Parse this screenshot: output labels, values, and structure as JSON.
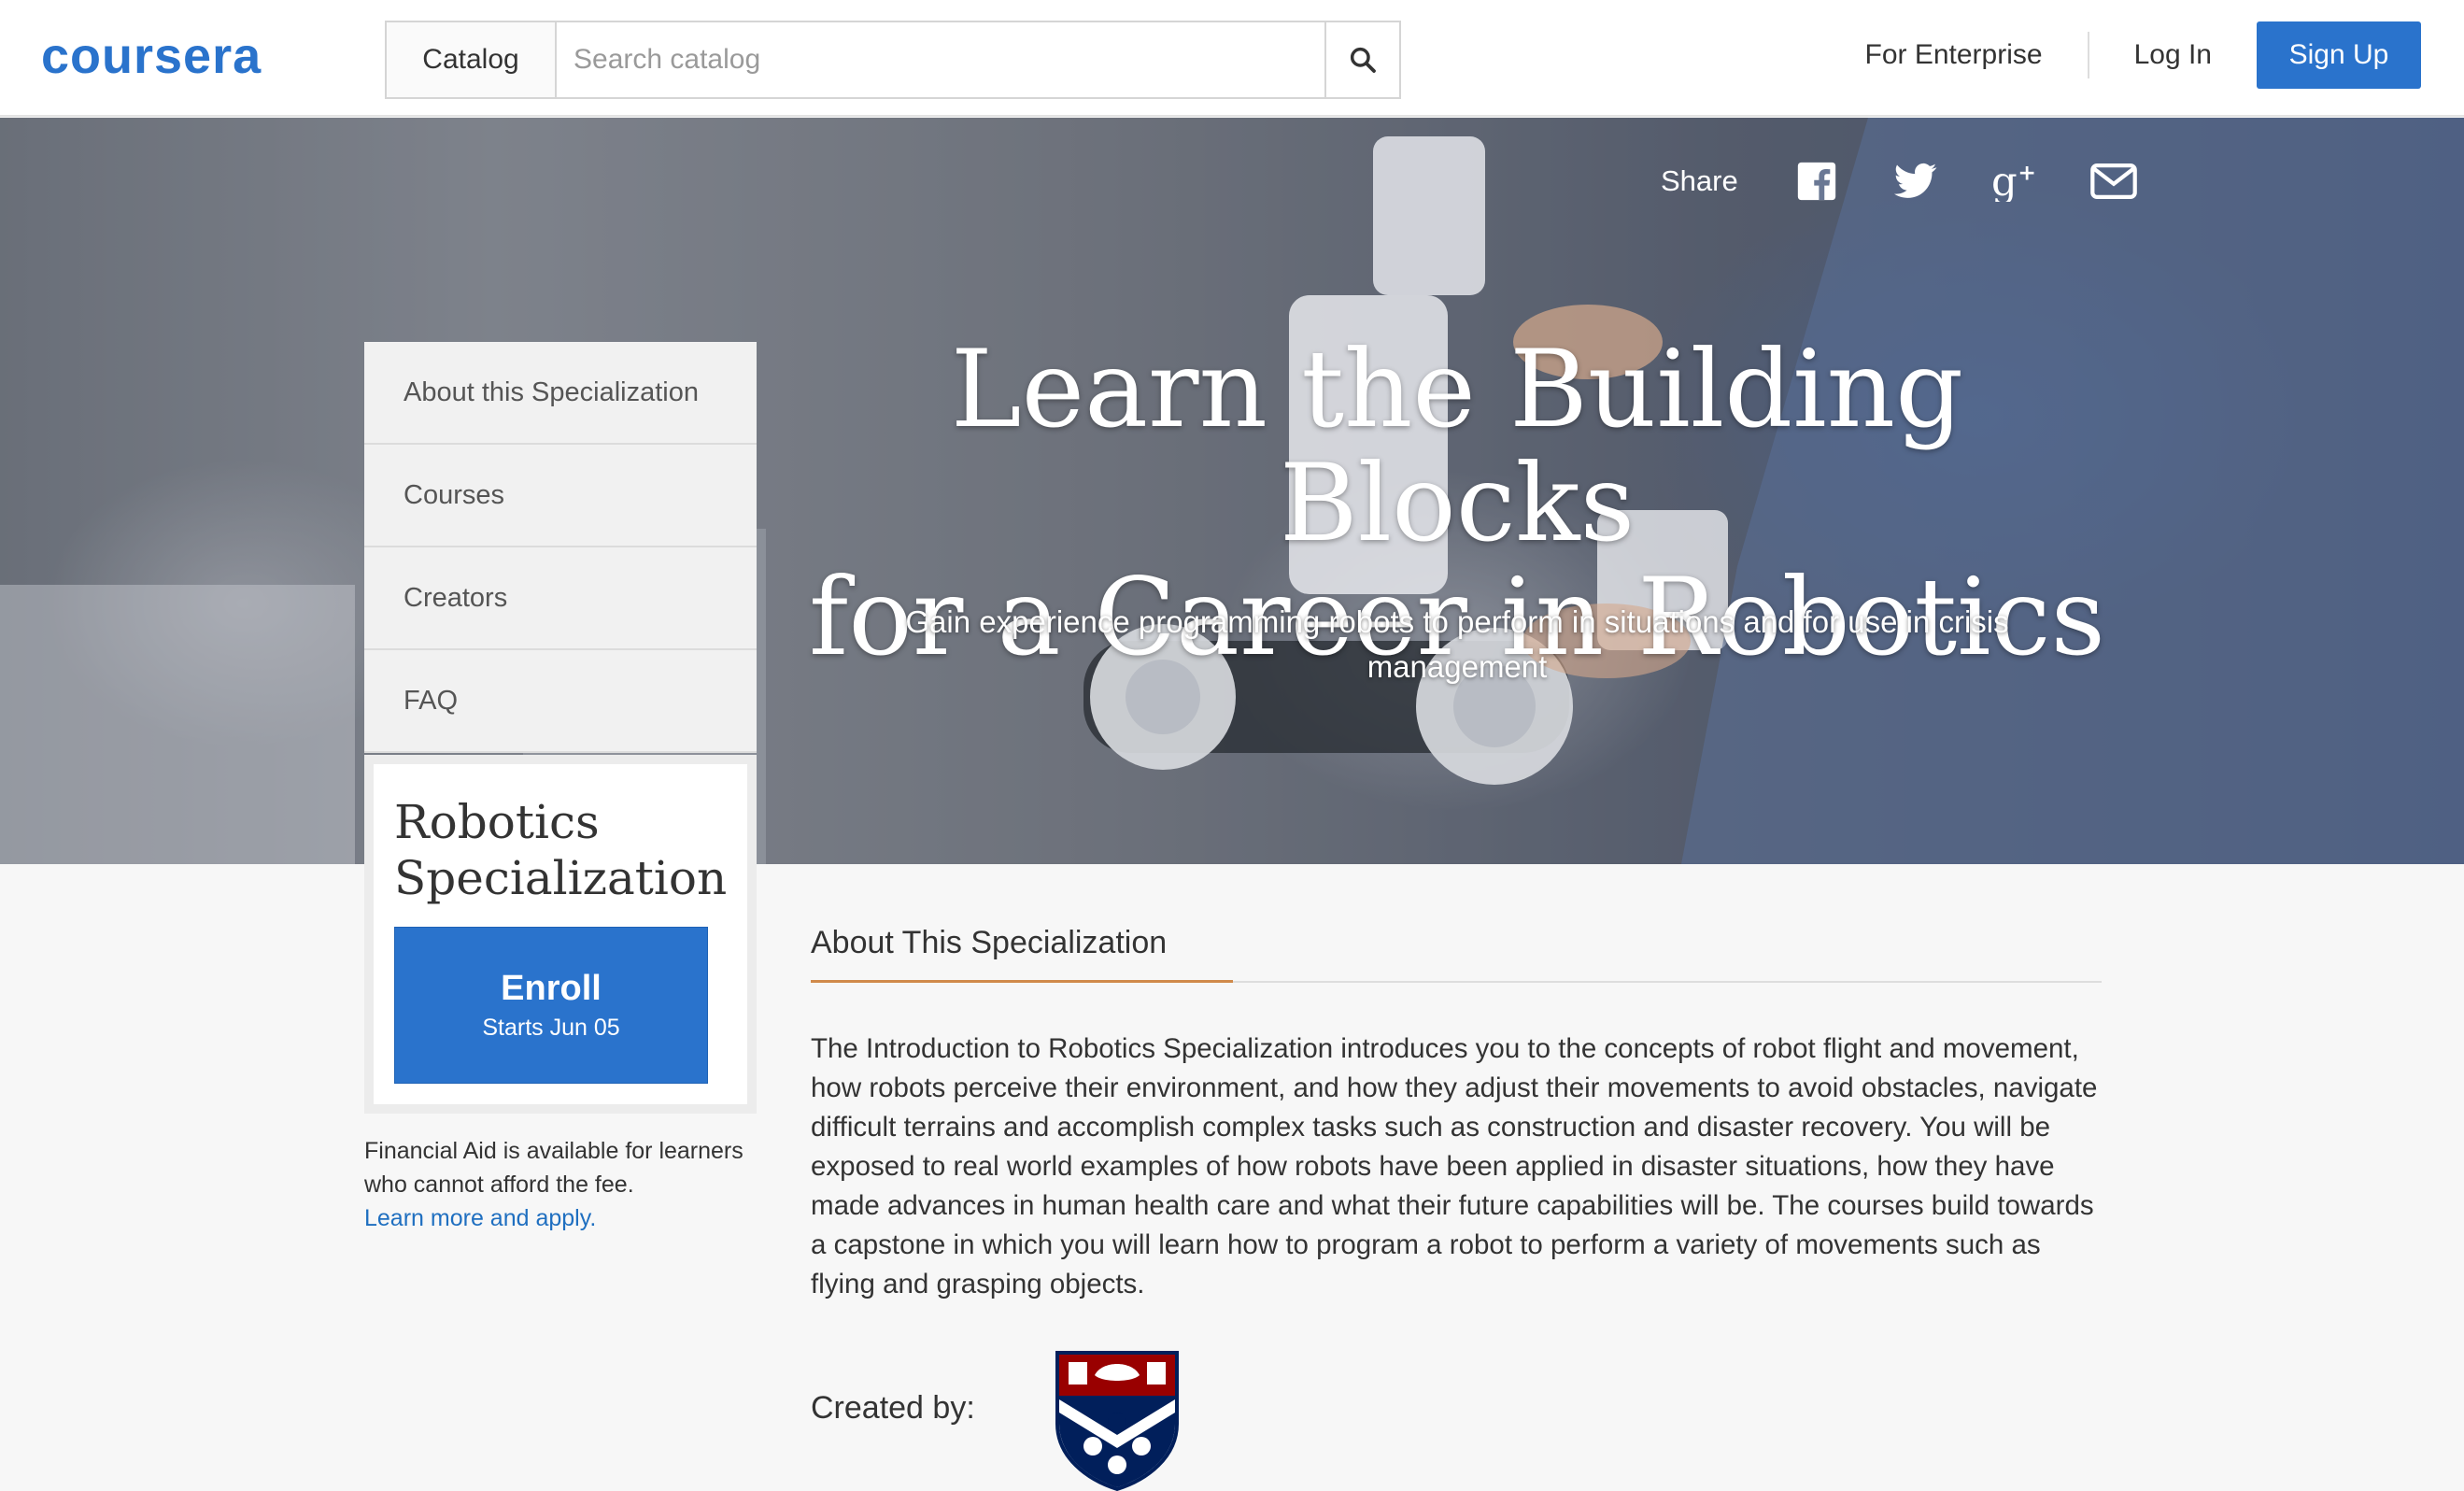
{
  "header": {
    "logo_text": "coursera",
    "catalog_label": "Catalog",
    "search_placeholder": "Search catalog",
    "for_enterprise": "For Enterprise",
    "log_in": "Log In",
    "sign_up": "Sign Up"
  },
  "hero": {
    "share_label": "Share",
    "title_line1": "Learn the Building Blocks",
    "title_line2": "for a Career in Robotics",
    "subtitle": "Gain experience programming robots to perform in situations and for use in crisis management"
  },
  "side_nav": {
    "items": [
      {
        "label": "About this Specialization"
      },
      {
        "label": "Courses"
      },
      {
        "label": "Creators"
      },
      {
        "label": "FAQ"
      }
    ]
  },
  "enroll_card": {
    "title_line1": "Robotics",
    "title_line2": "Specialization",
    "enroll_label": "Enroll",
    "starts": "Starts Jun 05"
  },
  "financial": {
    "text": "Financial Aid is available for learners who cannot afford the fee.",
    "link": "Learn more and apply."
  },
  "about": {
    "heading": "About This Specialization",
    "body": "The Introduction to Robotics Specialization introduces you to the concepts of robot flight and movement, how robots perceive their environment, and how they adjust their movements to avoid obstacles, navigate difficult terrains and accomplish complex tasks such as construction and disaster recovery. You will be exposed to real world examples of how robots have been applied in disaster situations, how they have made advances in human health care and what their future capabilities will be. The courses build towards a capstone in which you will learn how to program a robot to perform a variety of movements such as flying and grasping objects.",
    "created_by": "Created by:"
  },
  "colors": {
    "brand_blue": "#2a73cc",
    "accent_orange": "#d08a4b",
    "penn_red": "#990000",
    "penn_blue": "#011f5b"
  },
  "icons": [
    "search-icon",
    "facebook-icon",
    "twitter-icon",
    "google-plus-icon",
    "email-icon"
  ]
}
